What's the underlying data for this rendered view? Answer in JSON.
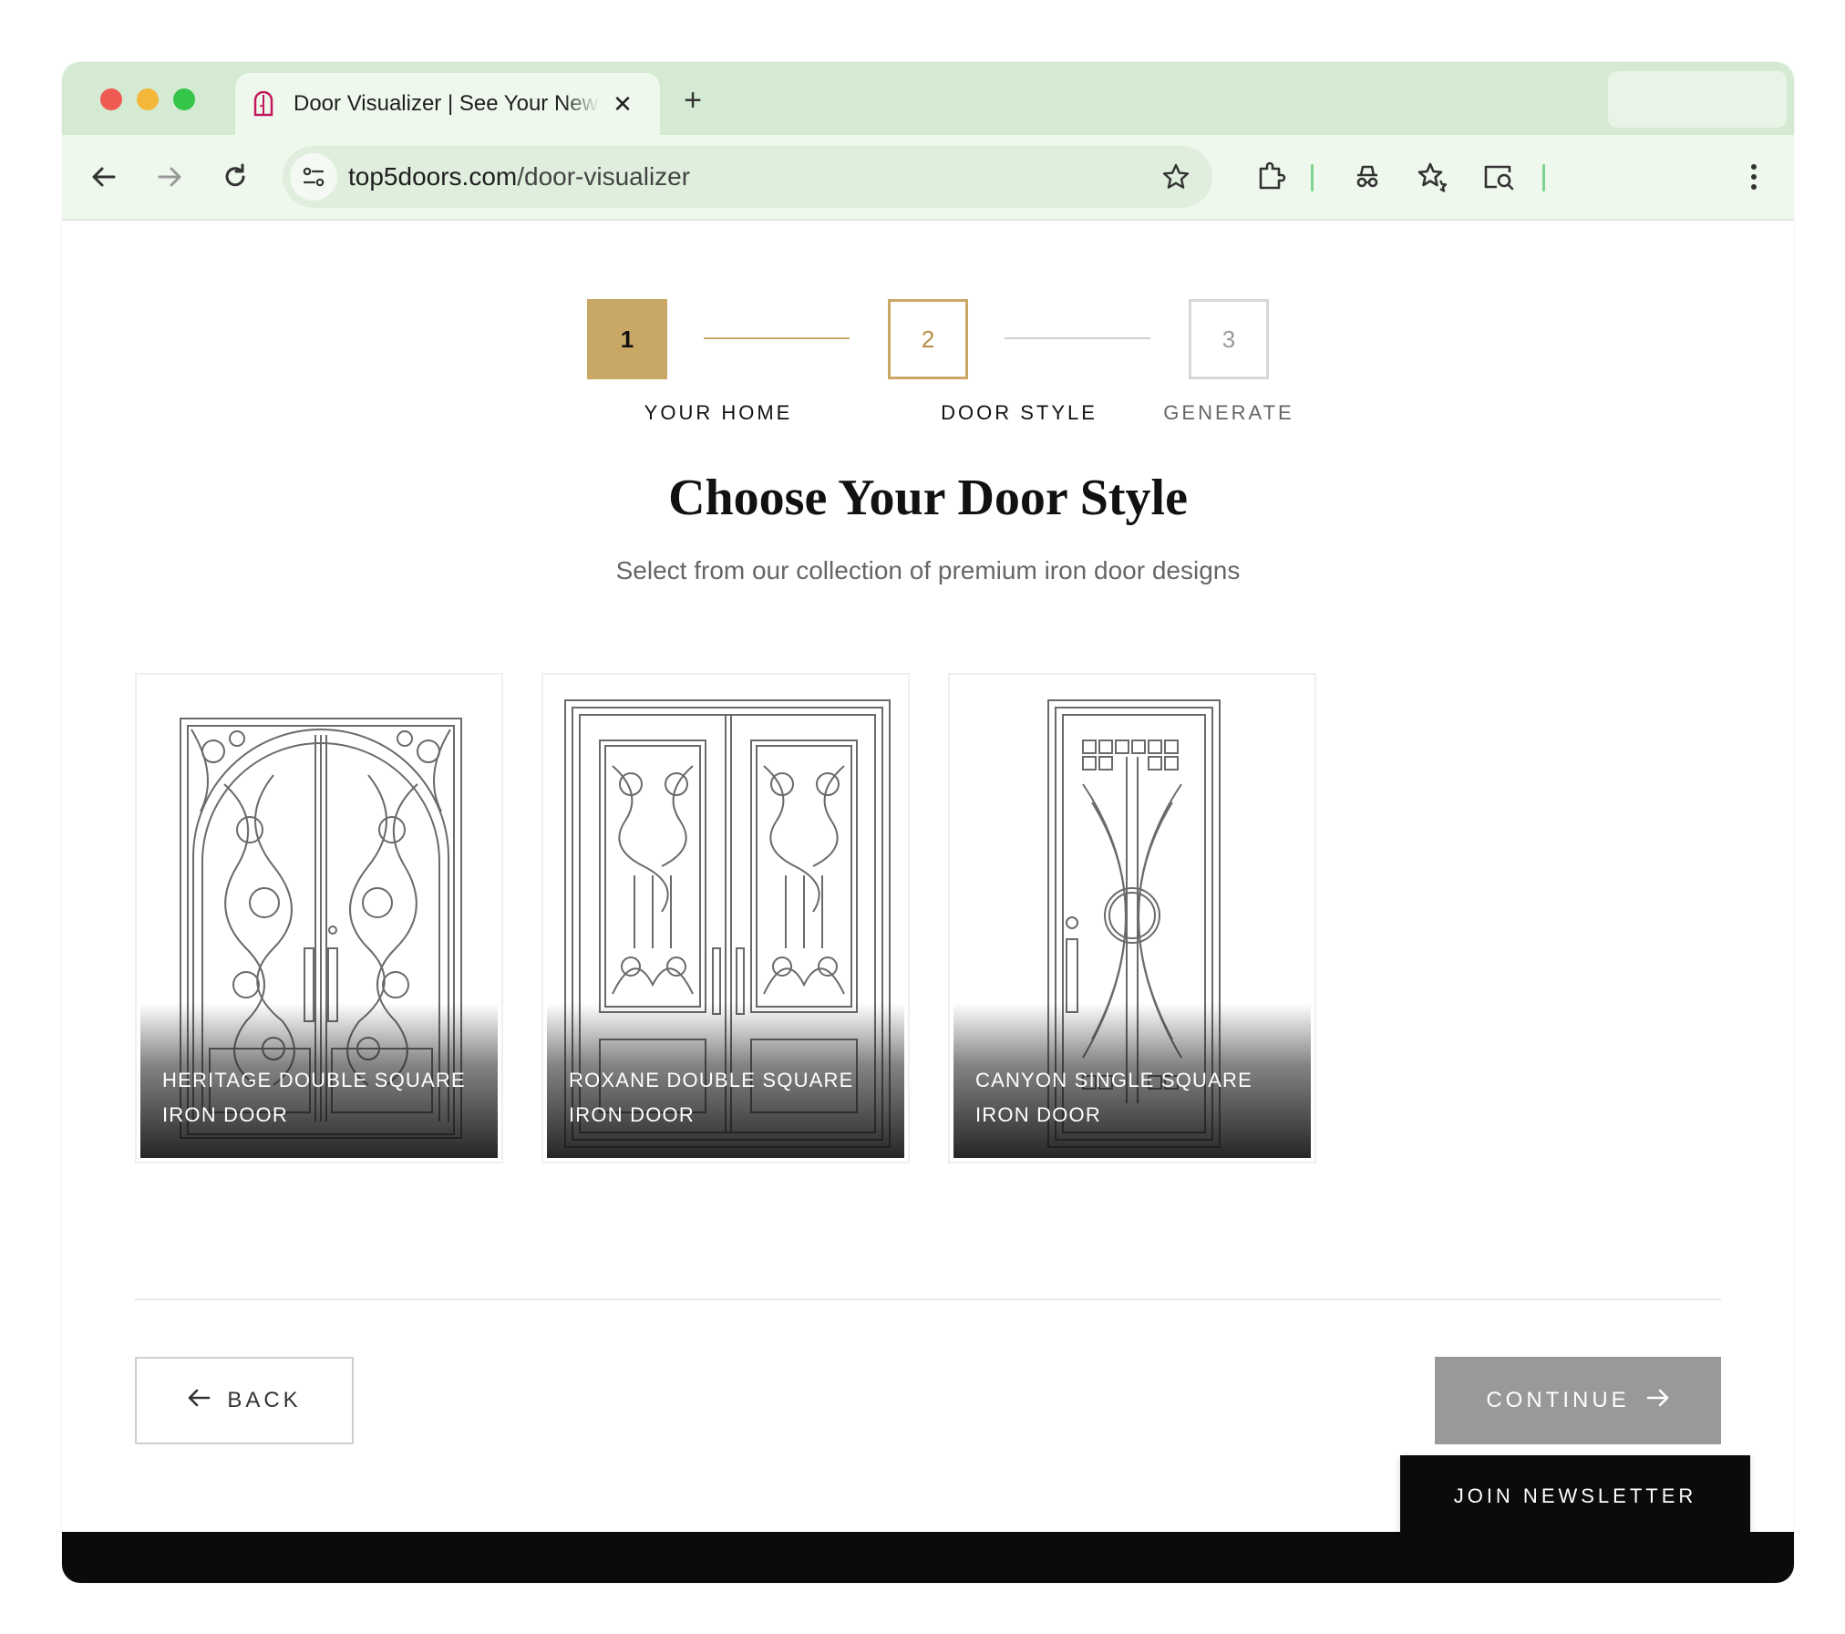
{
  "browser": {
    "tab_title": "Door Visualizer | See Your New Iron Door",
    "tab_close": "✕",
    "new_tab": "+",
    "url_domain": "top5doors.com",
    "url_path": "/door-visualizer"
  },
  "steps": [
    {
      "number": "1",
      "label": "YOUR HOME",
      "state": "completed"
    },
    {
      "number": "2",
      "label": "DOOR STYLE",
      "state": "active"
    },
    {
      "number": "3",
      "label": "GENERATE",
      "state": "pending"
    }
  ],
  "colors": {
    "accent": "#c9a765",
    "disabled_button": "#999999",
    "dark": "#0b0b0b"
  },
  "main": {
    "title": "Choose Your Door Style",
    "subtitle": "Select from our collection of premium iron door designs"
  },
  "doors": [
    {
      "name": "HERITAGE DOUBLE SQUARE IRON DOOR"
    },
    {
      "name": "ROXANE DOUBLE SQUARE IRON DOOR"
    },
    {
      "name": "CANYON SINGLE SQUARE IRON DOOR"
    }
  ],
  "nav": {
    "back_label": "BACK",
    "continue_label": "CONTINUE"
  },
  "newsletter": {
    "label": "JOIN NEWSLETTER"
  }
}
